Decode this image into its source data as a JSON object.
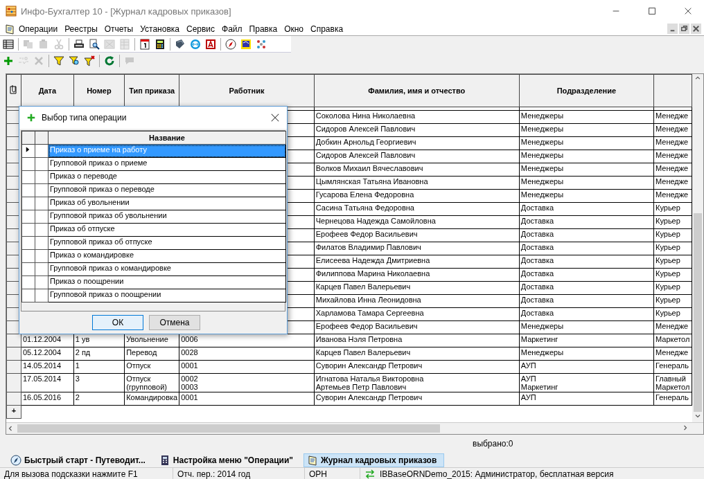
{
  "window": {
    "title": "Инфо-Бухгалтер 10 - [Журнал кадровых приказов]"
  },
  "menu": [
    "Операции",
    "Реестры",
    "Отчеты",
    "Установка",
    "Сервис",
    "Файл",
    "Правка",
    "Окно",
    "Справка"
  ],
  "toolbar_1": [
    {
      "disabled": false
    },
    {
      "disabled": true
    },
    {
      "disabled": true
    },
    {
      "disabled": true
    },
    {
      "disabled": false
    },
    {
      "disabled": false
    },
    {
      "disabled": true
    },
    {
      "disabled": true
    },
    {
      "disabled": false
    },
    {
      "disabled": false
    },
    {
      "disabled": false
    },
    {
      "disabled": false
    },
    {
      "disabled": false
    },
    {
      "disabled": false
    },
    {
      "disabled": false
    },
    {
      "disabled": false
    }
  ],
  "toolbar_2": [
    {
      "disabled": false
    },
    {
      "disabled": true
    },
    {
      "disabled": true
    },
    {
      "disabled": false
    },
    {
      "disabled": false
    },
    {
      "disabled": false
    },
    {
      "disabled": false
    },
    {
      "disabled": true
    }
  ],
  "table": {
    "columns": [
      "Дата",
      "Номер",
      "Тип приказа",
      "Работник",
      "Фамилия, имя и отчество",
      "Подразделение"
    ],
    "rows": [
      {
        "full_name": "Соколова Нина Николаевна",
        "department": "Менеджеры",
        "column_8": "Менедже"
      },
      {
        "full_name": "Сидоров Алексей Павлович",
        "department": "Менеджеры",
        "column_8": "Менедже"
      },
      {
        "full_name": "Добкин Арнольд Георгиевич",
        "department": "Менеджеры",
        "column_8": "Менедже"
      },
      {
        "full_name": "Сидоров Алексей Павлович",
        "department": "Менеджеры",
        "column_8": "Менедже"
      },
      {
        "full_name": "Волков Михаил Вячеславович",
        "department": "Менеджеры",
        "column_8": "Менедже"
      },
      {
        "full_name": "Цымлянская Татьяна Ивановна",
        "department": "Менеджеры",
        "column_8": "Менедже"
      },
      {
        "full_name": "Гусарова Елена Федоровна",
        "department": "Менеджеры",
        "column_8": "Менедже"
      },
      {
        "full_name": "Сасина Татьяна Федоровна",
        "department": "Доставка",
        "column_8": "Курьер"
      },
      {
        "full_name": "Чернецова Надежда Самойловна",
        "department": "Доставка",
        "column_8": "Курьер"
      },
      {
        "full_name": "Ерофеев Федор Васильевич",
        "department": "Доставка",
        "column_8": "Курьер"
      },
      {
        "full_name": "Филатов Владимир Павлович",
        "department": "Доставка",
        "column_8": "Курьер"
      },
      {
        "full_name": "Елисеева Надежда Дмитриевна",
        "department": "Доставка",
        "column_8": "Курьер"
      },
      {
        "full_name": "Филиппова Марина Николаевна",
        "department": "Доставка",
        "column_8": "Курьер"
      },
      {
        "full_name": "Карцев Павел Валерьевич",
        "department": "Доставка",
        "column_8": "Курьер"
      },
      {
        "full_name": "Михайлова Инна Леонидовна",
        "department": "Доставка",
        "column_8": "Курьер"
      },
      {
        "full_name": "Харламова Тамара Сергеевна",
        "department": "Доставка",
        "column_8": "Курьер"
      },
      {
        "full_name": "Ерофеев Федор Васильевич",
        "department": "Менеджеры",
        "column_8": "Менедже"
      },
      {
        "date": "01.12.2004",
        "number": "1 ув",
        "order_type": "Увольнение",
        "employee": "0006",
        "full_name": "Иванова Нэля Петровна",
        "department": "Маркетинг",
        "column_8": "Маркетол"
      },
      {
        "date": "05.12.2004",
        "number": "2 пд",
        "order_type": "Перевод",
        "employee": "0028",
        "full_name": "Карцев Павел Валерьевич",
        "department": "Менеджеры",
        "column_8": "Менедже"
      },
      {
        "date": "14.05.2014",
        "number": "1",
        "order_type": "Отпуск",
        "employee": "0001",
        "full_name": "Суворин Александр Петрович",
        "department": "АУП",
        "column_8": "Генераль"
      },
      {
        "date": "17.05.2014",
        "number": "3",
        "order_type": "Отпуск\n(групповой)",
        "employee": "0002\n0003",
        "full_name": "Игнатова Наталья Викторовна\nАртемьев Петр Павлович",
        "department": "АУП\nМаркетинг",
        "column_8": "Главный\nМаркетол"
      },
      {
        "date": "16.05.2016",
        "number": "2",
        "order_type": "Командировка",
        "employee": "0001",
        "full_name": "Суворин Александр Петрович",
        "department": "АУП",
        "column_8": "Генераль"
      }
    ],
    "new_row_marker": "+"
  },
  "dialog": {
    "title": "Выбор типа операции",
    "column": "Название",
    "items": [
      {
        "label": "Приказ о приеме на работу",
        "selected": true
      },
      {
        "label": "Групповой приказ о приеме",
        "selected": false
      },
      {
        "label": "Приказ о переводе",
        "selected": false
      },
      {
        "label": "Групповой приказ о переводе",
        "selected": false
      },
      {
        "label": "Приказ об увольнении",
        "selected": false
      },
      {
        "label": "Групповой приказ об увольнении",
        "selected": false
      },
      {
        "label": "Приказ об отпуске",
        "selected": false
      },
      {
        "label": "Групповой приказ об отпуске",
        "selected": false
      },
      {
        "label": "Приказ о командировке",
        "selected": false
      },
      {
        "label": "Групповой приказ о командировке",
        "selected": false
      },
      {
        "label": "Приказ о поощрении",
        "selected": false
      },
      {
        "label": "Групповой приказ о поощрении",
        "selected": false
      }
    ],
    "buttons": [
      {
        "label": "ОК",
        "focused": true
      },
      {
        "label": "Отмена",
        "focused": false
      }
    ]
  },
  "selected_count": "выбрано:0",
  "tabs": [
    {
      "label": "Быстрый старт - Путеводит...",
      "selected": false
    },
    {
      "label": "Настройка меню \"Операции\"",
      "selected": false
    },
    {
      "label": "Журнал кадровых приказов",
      "selected": true
    }
  ],
  "status_bar": [
    "Для вызова подсказки нажмите F1",
    "Отч. пер.: 2014 год",
    "ОРН",
    "IBBaseORNDemo_2015: Администратор, бесплатная версия"
  ]
}
